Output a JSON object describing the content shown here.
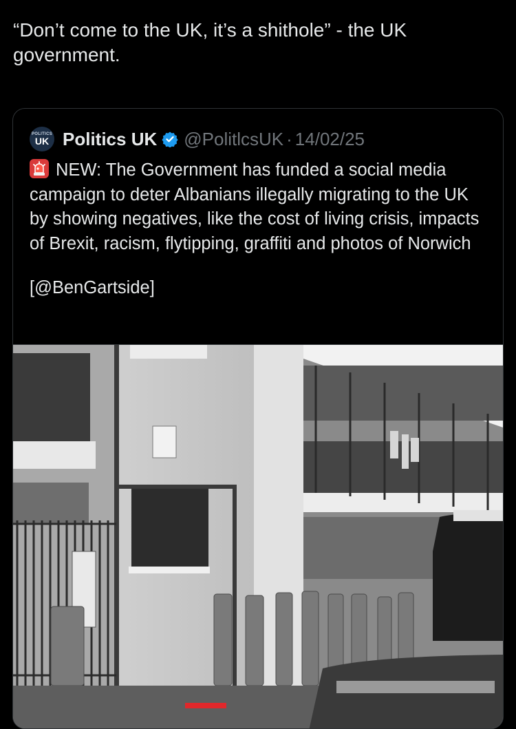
{
  "tweet": {
    "text": "“Don’t come to the UK, it’s a shithole” - the UK government."
  },
  "quoted_tweet": {
    "avatar_text_top": "POLITICS",
    "avatar_text_bottom": "UK",
    "display_name": "Politics UK",
    "handle": "@PolitlcsUK",
    "separator": "·",
    "date": "14/02/25",
    "body": "NEW: The Government has funded a social media campaign to deter Albanians illegally migrating to the UK by showing negatives, like the cost of living crisis, impacts of Brexit, racism, flytipping, graffiti and photos of Norwich",
    "credit": "[@BenGartside]",
    "icons": {
      "alert": "siren-icon",
      "verified": "verified-badge-icon"
    }
  },
  "colors": {
    "background": "#000000",
    "text": "#e7e9ea",
    "muted": "#71767b",
    "verified": "#1d9bf0",
    "border": "#2f3336",
    "photo_accent": "#e0282b"
  }
}
